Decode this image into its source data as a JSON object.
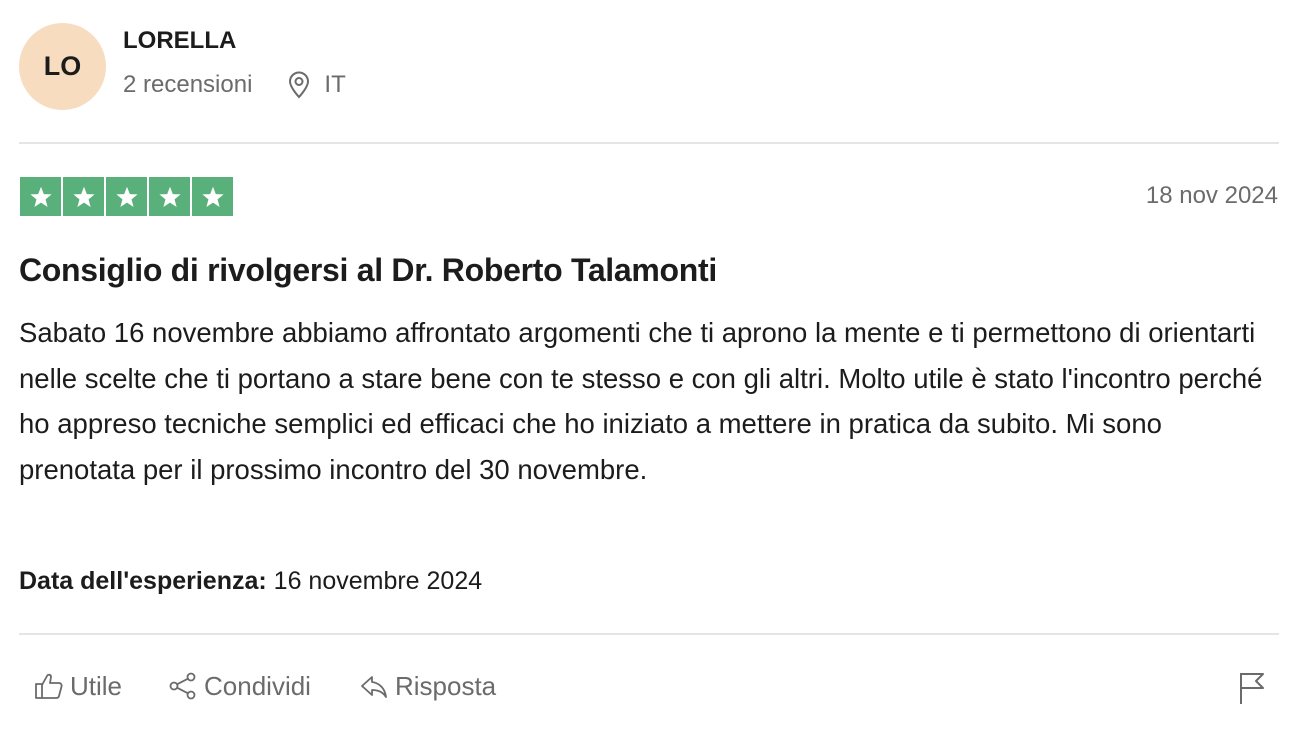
{
  "reviewer": {
    "initials": "LO",
    "name": "LORELLA",
    "reviews_count": "2 recensioni",
    "country": "IT",
    "avatar_color": "#f7dcc0"
  },
  "review": {
    "rating": 5,
    "max_rating": 5,
    "star_color": "#59b07a",
    "date": "18 nov 2024",
    "title": "Consiglio di rivolgersi al Dr. Roberto Talamonti",
    "body": "Sabato 16 novembre abbiamo affrontato argomenti che ti aprono la mente e ti permettono di orientarti nelle scelte che ti portano a stare bene con te stesso e con gli altri. Molto utile è stato l'incontro perché ho appreso tecniche semplici ed efficaci che ho iniziato a mettere in pratica da subito. Mi sono prenotata per il prossimo incontro del 30 novembre.",
    "experience_label": "Data dell'esperienza:",
    "experience_date": " 16 novembre 2024"
  },
  "actions": {
    "useful": "Utile",
    "share": "Condividi",
    "reply": "Risposta",
    "useful_icon": "thumbs-up-icon",
    "share_icon": "share-icon",
    "reply_icon": "reply-icon",
    "flag_icon": "flag-icon"
  }
}
